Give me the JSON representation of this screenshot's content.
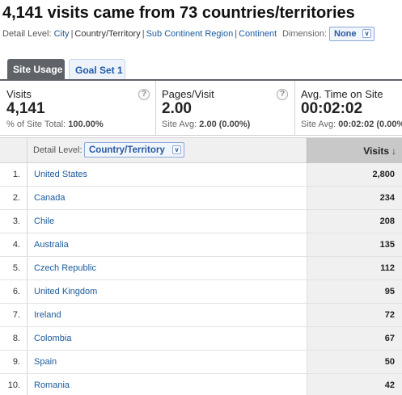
{
  "header": {
    "title": "4,141 visits came from 73 countries/territories"
  },
  "detail_bar": {
    "label": "Detail Level:",
    "options": [
      "City",
      "Country/Territory",
      "Sub Continent Region",
      "Continent"
    ],
    "current": "Country/Territory",
    "dimension_label": "Dimension:",
    "dimension_value": "None"
  },
  "tabs": [
    {
      "label": "Site Usage",
      "active": true
    },
    {
      "label": "Goal Set 1",
      "active": false
    }
  ],
  "scorecards": [
    {
      "label": "Visits",
      "value": "4,141",
      "sub_label": "% of Site Total:",
      "sub_value": "100.00%",
      "help": "?"
    },
    {
      "label": "Pages/Visit",
      "value": "2.00",
      "sub_label": "Site Avg:",
      "sub_value": "2.00 (0.00%)",
      "help": "?"
    },
    {
      "label": "Avg. Time on Site",
      "value": "00:02:02",
      "sub_label": "Site Avg:",
      "sub_value": "00:02:02 (0.00%)"
    }
  ],
  "table": {
    "detail_label": "Detail Level:",
    "detail_value": "Country/Territory",
    "visits_header": "Visits",
    "sort_icon": "arrow-down",
    "rows": [
      {
        "idx": "1.",
        "name": "United States",
        "visits": "2,800"
      },
      {
        "idx": "2.",
        "name": "Canada",
        "visits": "234"
      },
      {
        "idx": "3.",
        "name": "Chile",
        "visits": "208"
      },
      {
        "idx": "4.",
        "name": "Australia",
        "visits": "135"
      },
      {
        "idx": "5.",
        "name": "Czech Republic",
        "visits": "112"
      },
      {
        "idx": "6.",
        "name": "United Kingdom",
        "visits": "95"
      },
      {
        "idx": "7.",
        "name": "Ireland",
        "visits": "72"
      },
      {
        "idx": "8.",
        "name": "Colombia",
        "visits": "67"
      },
      {
        "idx": "9.",
        "name": "Spain",
        "visits": "50"
      },
      {
        "idx": "10.",
        "name": "Romania",
        "visits": "42"
      }
    ]
  },
  "colors": {
    "link": "#1a5a9c",
    "tab_active": "#5f6368",
    "sorted_header": "#c8c8c8"
  }
}
